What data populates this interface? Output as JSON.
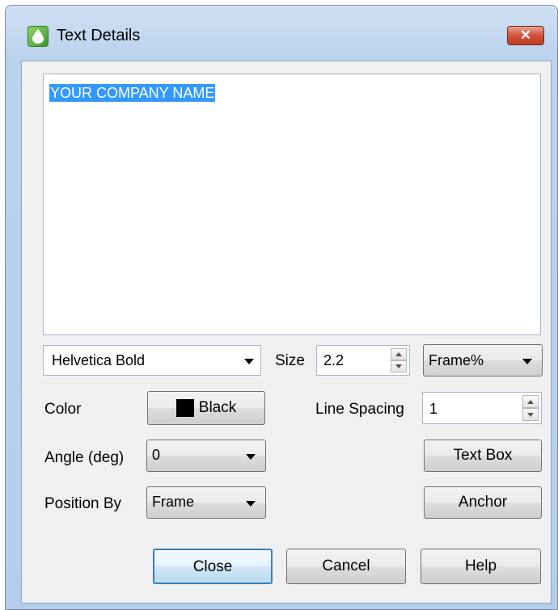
{
  "window": {
    "title": "Text Details",
    "close_glyph": "✕"
  },
  "editor": {
    "text": "YOUR COMPANY NAME"
  },
  "font": {
    "value": "Helvetica Bold"
  },
  "size": {
    "label": "Size",
    "value": "2.2",
    "unit": "Frame%"
  },
  "color": {
    "label": "Color",
    "button_label": "Black",
    "swatch_color": "#000000"
  },
  "line_spacing": {
    "label": "Line Spacing",
    "value": "1"
  },
  "angle": {
    "label": "Angle (deg)",
    "value": "0"
  },
  "position": {
    "label": "Position By",
    "value": "Frame"
  },
  "buttons": {
    "text_box": "Text Box",
    "anchor": "Anchor",
    "close": "Close",
    "cancel": "Cancel",
    "help": "Help"
  },
  "icons": [
    "app-icon",
    "close-icon",
    "dropdown-arrow-icon",
    "spin-up-icon",
    "spin-down-icon",
    "color-swatch-icon"
  ]
}
